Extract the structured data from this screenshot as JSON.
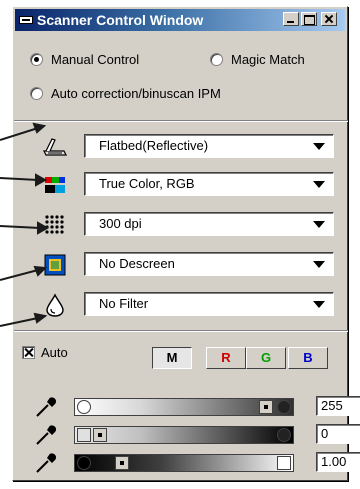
{
  "window": {
    "title": "Scanner Control Window"
  },
  "mode": {
    "manual_label": "Manual Control",
    "magic_label": "Magic Match",
    "auto_label": "Auto correction/binuscan IPM",
    "selected": "manual"
  },
  "dropdowns": {
    "source": {
      "value": "Flatbed(Reflective)",
      "icon": "scanner-icon"
    },
    "color_mode": {
      "value": "True Color, RGB",
      "icon": "color-mode-icon"
    },
    "resolution": {
      "value": "300 dpi",
      "icon": "resolution-dots-icon"
    },
    "descreen": {
      "value": "No Descreen",
      "icon": "descreen-icon"
    },
    "filter": {
      "value": "No Filter",
      "icon": "filter-drop-icon"
    }
  },
  "auto": {
    "label": "Auto",
    "checked": true
  },
  "channels": {
    "m": "M",
    "r": "R",
    "g": "G",
    "b": "B",
    "active": "M"
  },
  "levels": {
    "highlight": "255",
    "shadow": "0",
    "gamma": "1.00"
  }
}
